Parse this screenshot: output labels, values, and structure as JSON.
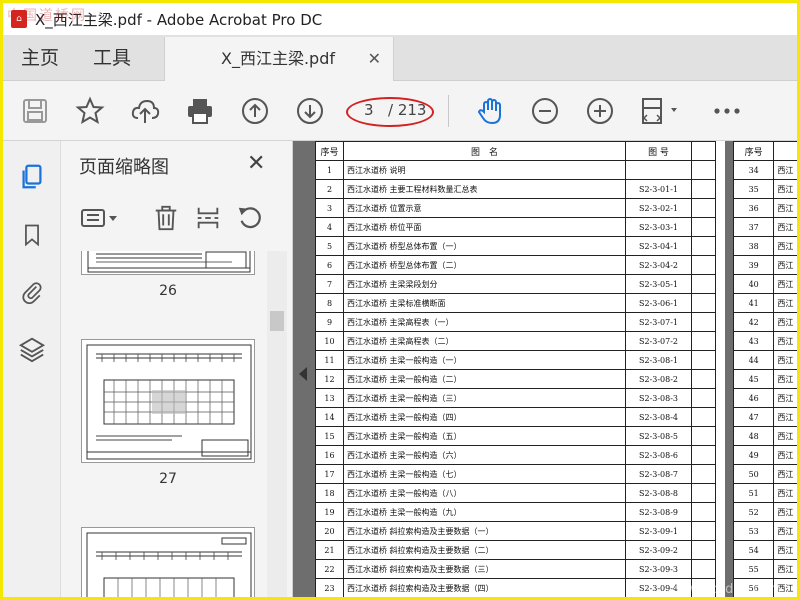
{
  "window": {
    "watermark_top": "中国道桥网",
    "title": "X_西江主梁.pdf - Adobe Acrobat Pro DC",
    "app_icon": "acrobat-icon"
  },
  "tabs": {
    "home": "主页",
    "tools": "工具",
    "document": "X_西江主梁.pdf",
    "close_icon": "close-icon"
  },
  "toolbar": {
    "page_current": "3",
    "page_total": "/ 213",
    "highlight_color": "#d42020",
    "icons": [
      "save-icon",
      "star-icon",
      "upload-icon",
      "print-icon",
      "page-up-icon",
      "page-down-icon",
      "hand-icon",
      "zoom-out-icon",
      "zoom-in-icon",
      "fit-page-icon",
      "more-icon"
    ]
  },
  "panel": {
    "title": "页面缩略图",
    "thumbnails": [
      {
        "label": "26"
      },
      {
        "label": "27"
      }
    ]
  },
  "document": {
    "headers": {
      "no": "序号",
      "name": "图　名",
      "code": "图 号"
    },
    "rows": [
      {
        "no": "1",
        "name": "西江水道桥 说明",
        "code": ""
      },
      {
        "no": "2",
        "name": "西江水道桥 主要工程材料数量汇总表",
        "code": "S2-3-01-1"
      },
      {
        "no": "3",
        "name": "西江水道桥 位置示意",
        "code": "S2-3-02-1"
      },
      {
        "no": "4",
        "name": "西江水道桥 桥位平面",
        "code": "S2-3-03-1"
      },
      {
        "no": "5",
        "name": "西江水道桥 桥型总体布置（一）",
        "code": "S2-3-04-1"
      },
      {
        "no": "6",
        "name": "西江水道桥 桥型总体布置（二）",
        "code": "S2-3-04-2"
      },
      {
        "no": "7",
        "name": "西江水道桥 主梁梁段划分",
        "code": "S2-3-05-1"
      },
      {
        "no": "8",
        "name": "西江水道桥 主梁标准横断面",
        "code": "S2-3-06-1"
      },
      {
        "no": "9",
        "name": "西江水道桥 主梁高程表（一）",
        "code": "S2-3-07-1"
      },
      {
        "no": "10",
        "name": "西江水道桥 主梁高程表（二）",
        "code": "S2-3-07-2"
      },
      {
        "no": "11",
        "name": "西江水道桥 主梁一般构造（一）",
        "code": "S2-3-08-1"
      },
      {
        "no": "12",
        "name": "西江水道桥 主梁一般构造（二）",
        "code": "S2-3-08-2"
      },
      {
        "no": "13",
        "name": "西江水道桥 主梁一般构造（三）",
        "code": "S2-3-08-3"
      },
      {
        "no": "14",
        "name": "西江水道桥 主梁一般构造（四）",
        "code": "S2-3-08-4"
      },
      {
        "no": "15",
        "name": "西江水道桥 主梁一般构造（五）",
        "code": "S2-3-08-5"
      },
      {
        "no": "16",
        "name": "西江水道桥 主梁一般构造（六）",
        "code": "S2-3-08-6"
      },
      {
        "no": "17",
        "name": "西江水道桥 主梁一般构造（七）",
        "code": "S2-3-08-7"
      },
      {
        "no": "18",
        "name": "西江水道桥 主梁一般构造（八）",
        "code": "S2-3-08-8"
      },
      {
        "no": "19",
        "name": "西江水道桥 主梁一般构造（九）",
        "code": "S2-3-08-9"
      },
      {
        "no": "20",
        "name": "西江水道桥 斜拉索构造及主要数据（一）",
        "code": "S2-3-09-1"
      },
      {
        "no": "21",
        "name": "西江水道桥 斜拉索构造及主要数据（二）",
        "code": "S2-3-09-2"
      },
      {
        "no": "22",
        "name": "西江水道桥 斜拉索构造及主要数据（三）",
        "code": "S2-3-09-3"
      },
      {
        "no": "23",
        "name": "西江水道桥 斜拉索构造及主要数据（四）",
        "code": "S2-3-09-4"
      }
    ],
    "right_page": {
      "header": "序号",
      "numbers": [
        "34",
        "35",
        "36",
        "37",
        "38",
        "39",
        "40",
        "41",
        "42",
        "43",
        "44",
        "45",
        "46",
        "47",
        "48",
        "49",
        "50",
        "51",
        "52",
        "53",
        "54",
        "55",
        "56"
      ],
      "name_prefix": "西江"
    }
  },
  "watermark_bottom": "www.cndao.com"
}
